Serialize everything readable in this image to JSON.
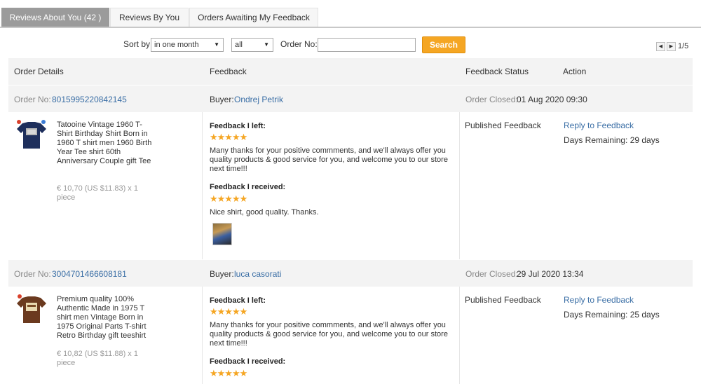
{
  "tabs": [
    {
      "label": "Reviews About You (42 )",
      "active": true
    },
    {
      "label": "Reviews By You",
      "active": false
    },
    {
      "label": "Orders Awaiting My Feedback",
      "active": false
    }
  ],
  "filter": {
    "sort_label": "Sort by",
    "period_value": "in one month",
    "type_value": "all",
    "order_no_label": "Order No:",
    "order_no_value": "",
    "search_button": "Search"
  },
  "pager": {
    "text": "1/5"
  },
  "columns": {
    "order_details": "Order Details",
    "feedback": "Feedback",
    "feedback_status": "Feedback Status",
    "action": "Action"
  },
  "orders": [
    {
      "order_no_label": "Order No:",
      "order_no": "8015995220842145",
      "buyer_label": "Buyer:",
      "buyer": "Ondrej Petrik",
      "closed_label": "Order Closed:",
      "closed_date": "01 Aug 2020 09:30",
      "product_title": "Tatooine Vintage 1960 T-Shirt Birthday Shirt Born in 1960 T shirt men 1960 Birth Year Tee shirt 60th Anniversary Couple gift Tee",
      "price": "€ 10,70 (US $11.83) x 1 piece",
      "left_heading": "Feedback I left:",
      "left_stars": "★★★★★",
      "left_text": "Many thanks for your positive commments, and we'll always offer you quality products & good service for you, and welcome you to our store next time!!!",
      "received_heading": "Feedback I received:",
      "received_stars": "★★★★★",
      "received_text": "Nice shirt, good quality. Thanks.",
      "status": "Published Feedback",
      "reply": "Reply to Feedback",
      "days_remaining": "Days Remaining: 29 days"
    },
    {
      "order_no_label": "Order No:",
      "order_no": "3004701466608181",
      "buyer_label": "Buyer:",
      "buyer": "luca casorati",
      "closed_label": "Order Closed:",
      "closed_date": "29 Jul 2020 13:34",
      "product_title": "Premium quality 100% Authentic Made in 1975 T shirt men Vintage Born in 1975 Original Parts T-shirt Retro Birthday gift teeshirt",
      "price": "€ 10,82 (US $11.88) x 1 piece",
      "left_heading": "Feedback I left:",
      "left_stars": "★★★★★",
      "left_text": "Many thanks for your positive commments, and we'll always offer you quality products & good service for you, and welcome you to our store next time!!!",
      "received_heading": "Feedback I received:",
      "received_stars": "★★★★★",
      "status": "Published Feedback",
      "reply": "Reply to Feedback",
      "days_remaining": "Days Remaining: 25 days"
    }
  ]
}
